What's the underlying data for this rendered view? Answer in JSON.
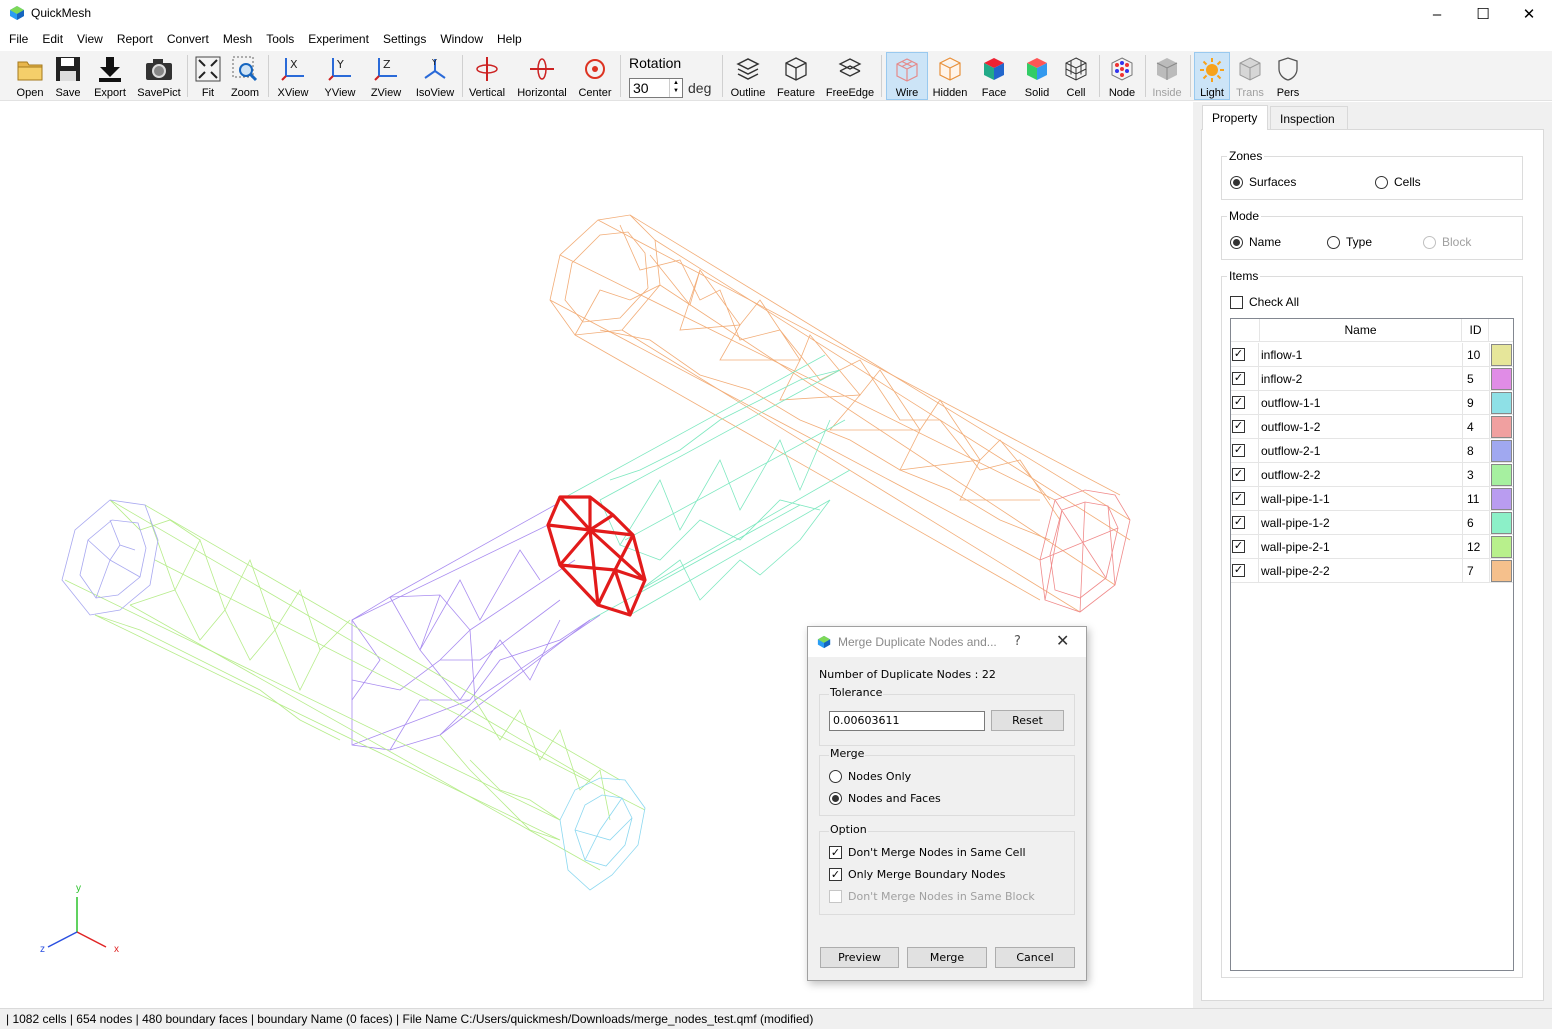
{
  "app": {
    "title": "QuickMesh",
    "window_controls": {
      "minimize": "–",
      "maximize": "☐",
      "close": "✕"
    }
  },
  "menu": [
    "File",
    "Edit",
    "View",
    "Report",
    "Convert",
    "Mesh",
    "Tools",
    "Experiment",
    "Settings",
    "Window",
    "Help"
  ],
  "toolbar": {
    "open": "Open",
    "save": "Save",
    "export": "Export",
    "savepict": "SavePict",
    "fit": "Fit",
    "zoom": "Zoom",
    "xview": "XView",
    "yview": "YView",
    "zview": "ZView",
    "isoview": "IsoView",
    "vertical": "Vertical",
    "horizontal": "Horizontal",
    "center": "Center",
    "rotation_label": "Rotation",
    "rotation_value": "30",
    "rotation_unit": "deg",
    "outline": "Outline",
    "feature": "Feature",
    "freeedge": "FreeEdge",
    "wire": "Wire",
    "hidden": "Hidden",
    "face": "Face",
    "solid": "Solid",
    "cell": "Cell",
    "node": "Node",
    "inside": "Inside",
    "light": "Light",
    "trans": "Trans",
    "pers": "Pers"
  },
  "axis_triad": {
    "x": "x",
    "y": "y",
    "z": "z"
  },
  "panel": {
    "tabs": [
      "Property",
      "Inspection"
    ],
    "zones": {
      "title": "Zones",
      "surfaces": "Surfaces",
      "cells": "Cells",
      "selected": "Surfaces"
    },
    "mode": {
      "title": "Mode",
      "name": "Name",
      "type": "Type",
      "block": "Block",
      "selected": "Name"
    },
    "items": {
      "title": "Items",
      "check_all": "Check All",
      "col_name": "Name",
      "col_id": "ID",
      "rows": [
        {
          "name": "inflow-1",
          "id": "10",
          "color": "#e6e69a",
          "checked": true
        },
        {
          "name": "inflow-2",
          "id": "5",
          "color": "#e08ce6",
          "checked": true
        },
        {
          "name": "outflow-1-1",
          "id": "9",
          "color": "#8ee0e6",
          "checked": true
        },
        {
          "name": "outflow-1-2",
          "id": "4",
          "color": "#f0a0a0",
          "checked": true
        },
        {
          "name": "outflow-2-1",
          "id": "8",
          "color": "#a0a8f0",
          "checked": true
        },
        {
          "name": "outflow-2-2",
          "id": "3",
          "color": "#a6f0a0",
          "checked": true
        },
        {
          "name": "wall-pipe-1-1",
          "id": "11",
          "color": "#b99cf0",
          "checked": true
        },
        {
          "name": "wall-pipe-1-2",
          "id": "6",
          "color": "#8cf0c8",
          "checked": true
        },
        {
          "name": "wall-pipe-2-1",
          "id": "12",
          "color": "#b8f08c",
          "checked": true
        },
        {
          "name": "wall-pipe-2-2",
          "id": "7",
          "color": "#f5c08c",
          "checked": true
        }
      ]
    }
  },
  "dialog": {
    "title": "Merge Duplicate Nodes and...",
    "help": "?",
    "close": "✕",
    "count_text": "Number of Duplicate Nodes : 22",
    "tolerance": {
      "title": "Tolerance",
      "value": "0.00603611",
      "reset": "Reset"
    },
    "merge": {
      "title": "Merge",
      "nodes_only": "Nodes Only",
      "nodes_and_faces": "Nodes and Faces",
      "selected": "Nodes and Faces"
    },
    "option": {
      "title": "Option",
      "same_cell": "Don't Merge Nodes in Same Cell",
      "boundary": "Only Merge Boundary Nodes",
      "same_block": "Don't Merge Nodes in Same Block"
    },
    "buttons": {
      "preview": "Preview",
      "merge": "Merge",
      "cancel": "Cancel"
    }
  },
  "status": " | 1082 cells | 654 nodes | 480 boundary faces |  boundary Name  (0 faces) | File Name C:/Users/quickmesh/Downloads/merge_nodes_test.qmf (modified)"
}
